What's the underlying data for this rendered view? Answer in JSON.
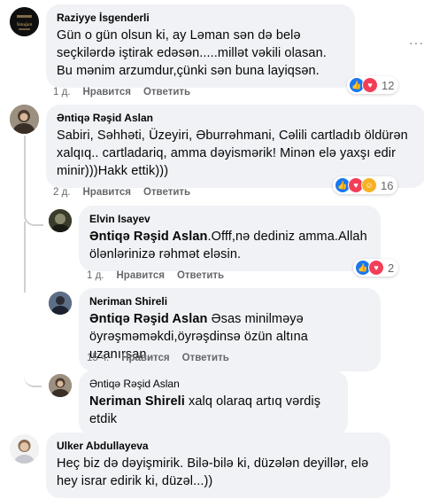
{
  "comments": [
    {
      "author": "Raziyye İsgenderli",
      "text": "Gün o gün olsun ki, ay Ləman sən də belə seçkilərdə iştirak edəsən.....millət vəkili olasan. Bu mənim arzumdur,çünki sən buna layiqsən.",
      "time": "1 д.",
      "like_label": "Нравится",
      "reply_label": "Ответить",
      "reaction_count": "12",
      "reactions": [
        "like-icon",
        "love-icon"
      ]
    },
    {
      "author": "Əntiqə Rəşid Aslan",
      "text": "Sabiri, Səhhəti, Üzeyiri, Əburrəhmani, Cəlili cartladıb öldürən xalqıq.. cartladariq, amma dəyismərik! Minən elə yaxşı edir minir)))Hakk ettik)))",
      "time": "2 д.",
      "like_label": "Нравится",
      "reply_label": "Ответить",
      "reaction_count": "16",
      "reactions": [
        "like-icon",
        "love-icon",
        "care-icon"
      ]
    },
    {
      "author": "Elvin Isayev",
      "mention": "Əntiqə Rəşid Aslan",
      "text": ".Offf,nə dediniz amma.Allah ölənlərinizə rəhmət eləsin.",
      "time": "1 д.",
      "like_label": "Нравится",
      "reply_label": "Ответить",
      "reaction_count": "2",
      "reactions": [
        "like-icon",
        "love-icon"
      ]
    },
    {
      "author": "Neriman Shireli",
      "mention": "Əntiqə Rəşid Aslan",
      "text": " Əsas minilməyə öyrəşməməkdi,öyrəşdinsə özün altına uzanırsan...",
      "time": "15 ч.",
      "like_label": "Нравится",
      "reply_label": "Ответить"
    },
    {
      "author": "Əntiqə Rəşid Aslan",
      "mention": "Neriman Shireli",
      "text": " xalq olaraq artıq vərdiş etdik"
    },
    {
      "author": "Ulker Abdullayeva",
      "text": "Heç biz də dəyişmirik. Bilə-bilə ki, düzələn deyillər, elə hey israr edirik ki, düzəl...))"
    }
  ],
  "avatar_text": "Yatağan",
  "menu_icon": "more-dots-icon",
  "colors": {
    "bubble": "#f0f2f5",
    "like": "#1877f2",
    "love": "#f33e58",
    "muted": "#65676b"
  }
}
